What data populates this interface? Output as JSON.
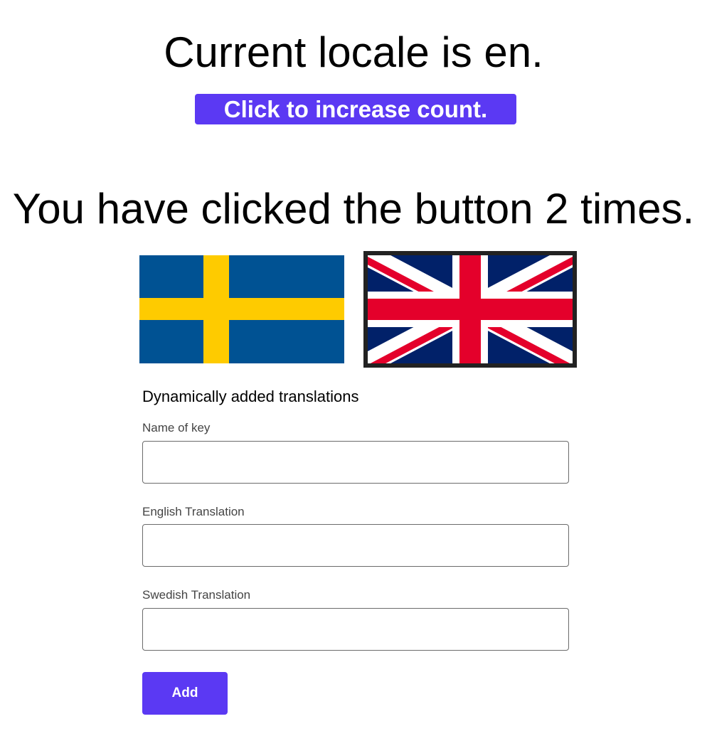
{
  "header": {
    "locale_text": "Current locale is en.",
    "increase_button_label": "Click to increase count.",
    "count_text": "You have clicked the button 2 times."
  },
  "flags": {
    "swedish": {
      "icon": "swedish-flag-icon",
      "colors": {
        "blue": "#005293",
        "yellow": "#fecb00"
      }
    },
    "uk": {
      "icon": "uk-flag-icon",
      "colors": {
        "blue": "#012169",
        "red": "#e4002b",
        "white": "#ffffff"
      }
    }
  },
  "form": {
    "title": "Dynamically added translations",
    "fields": [
      {
        "label": "Name of key",
        "value": "",
        "placeholder": ""
      },
      {
        "label": "English Translation",
        "value": "",
        "placeholder": ""
      },
      {
        "label": "Swedish Translation",
        "value": "",
        "placeholder": ""
      }
    ],
    "add_button_label": "Add"
  },
  "colors": {
    "accent": "#5b39f3",
    "button_text": "#ffffff",
    "label_text": "#444444"
  }
}
